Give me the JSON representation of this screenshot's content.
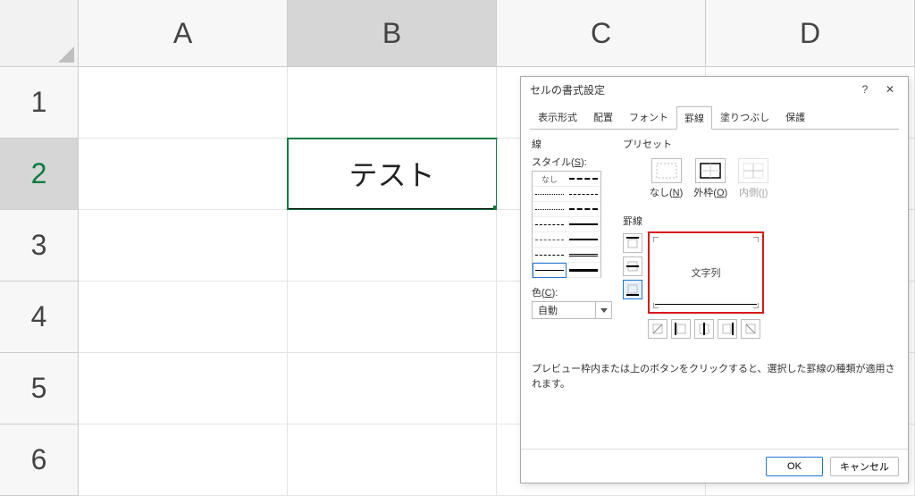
{
  "grid": {
    "columns": [
      "A",
      "B",
      "C",
      "D"
    ],
    "rows": [
      "1",
      "2",
      "3",
      "4",
      "5",
      "6"
    ],
    "activeCell": {
      "row": 1,
      "col": 1
    },
    "cells": {
      "B2": "テスト"
    }
  },
  "dialog": {
    "title": "セルの書式設定",
    "help": "?",
    "close": "✕",
    "tabs": {
      "number": "表示形式",
      "alignment": "配置",
      "font": "フォント",
      "border": "罫線",
      "fill": "塗りつぶし",
      "protection": "保護"
    },
    "line_group": "線",
    "style_label_pre": "スタイル(",
    "style_hotkey": "S",
    "style_label_post": "):",
    "style_none": "なし",
    "color_label_pre": "色(",
    "color_hotkey": "C",
    "color_label_post": "):",
    "color_value": "自動",
    "preset_group": "プリセット",
    "preset_none_pre": "なし(",
    "preset_none_hk": "N",
    "preset_none_post": ")",
    "preset_outline_pre": "外枠(",
    "preset_outline_hk": "O",
    "preset_outline_post": ")",
    "preset_inside_pre": "内側(",
    "preset_inside_hk": "I",
    "preset_inside_post": ")",
    "border_group": "罫線",
    "preview_text": "文字列",
    "hint": "プレビュー枠内または上のボタンをクリックすると、選択した罫線の種類が適用されます。",
    "ok": "OK",
    "cancel": "キャンセル"
  }
}
